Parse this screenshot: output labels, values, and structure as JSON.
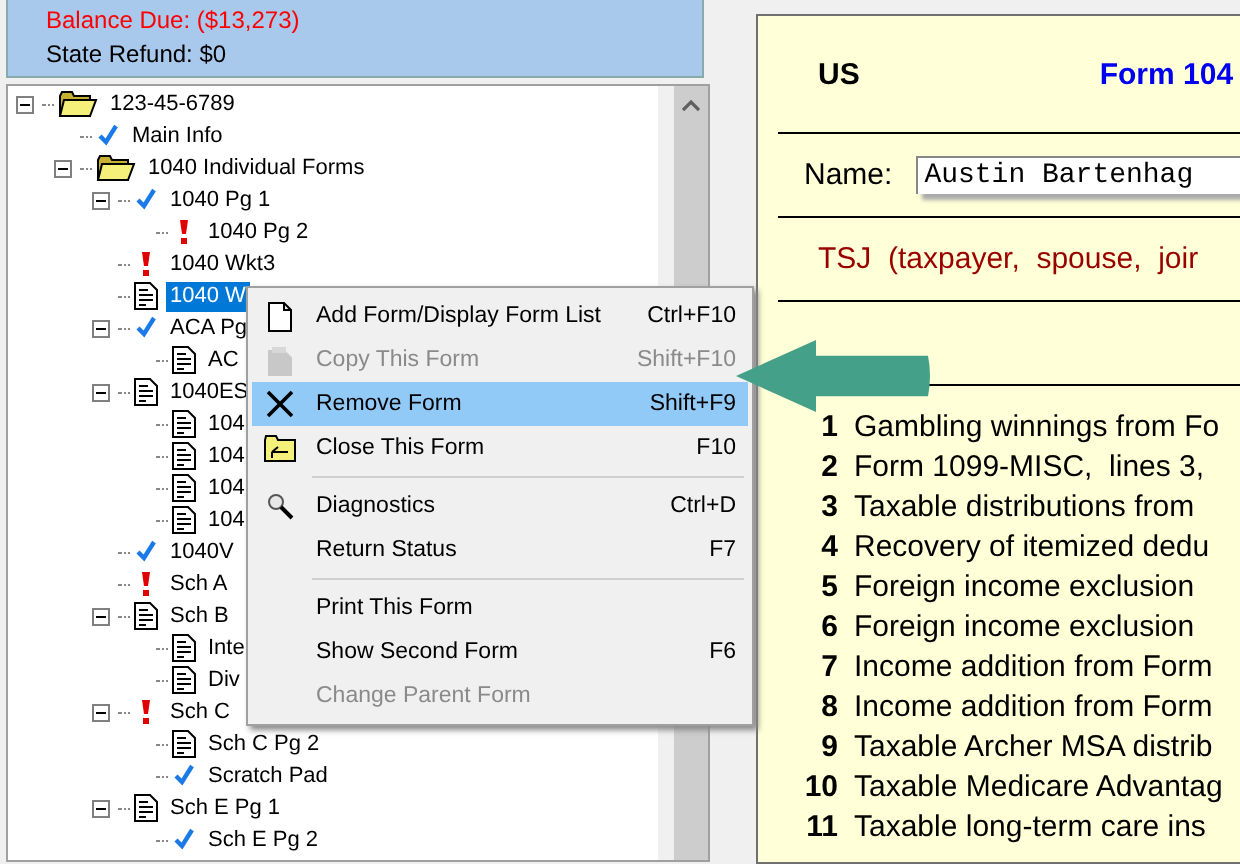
{
  "summary": {
    "balance_due": "Balance Due: ($13,273)",
    "state_refund": "State Refund: $0"
  },
  "tree": [
    {
      "label": "123-45-6789",
      "kind": "folder",
      "selected": false,
      "expanded": true,
      "children": [
        {
          "label": "Main Info",
          "kind": "check",
          "selected": false
        },
        {
          "label": "1040 Individual Forms",
          "kind": "folder",
          "selected": false,
          "expanded": true,
          "children": [
            {
              "label": "1040 Pg 1",
              "kind": "check",
              "selected": false,
              "expanded": true,
              "children": [
                {
                  "label": "1040 Pg 2",
                  "kind": "alert",
                  "selected": false
                }
              ]
            },
            {
              "label": "1040 Wkt3",
              "kind": "alert",
              "selected": false
            },
            {
              "label": "1040 W",
              "kind": "form",
              "selected": true
            },
            {
              "label": "ACA Pg",
              "kind": "check",
              "selected": false,
              "expanded": true,
              "children": [
                {
                  "label": "AC",
                  "kind": "form",
                  "selected": false
                }
              ]
            },
            {
              "label": "1040ES",
              "kind": "form",
              "selected": false,
              "expanded": true,
              "children": [
                {
                  "label": "104",
                  "kind": "form",
                  "selected": false
                },
                {
                  "label": "104",
                  "kind": "form",
                  "selected": false
                },
                {
                  "label": "104",
                  "kind": "form",
                  "selected": false
                },
                {
                  "label": "104",
                  "kind": "form",
                  "selected": false
                }
              ]
            },
            {
              "label": "1040V",
              "kind": "check",
              "selected": false
            },
            {
              "label": "Sch A",
              "kind": "alert",
              "selected": false
            },
            {
              "label": "Sch B",
              "kind": "form",
              "selected": false,
              "expanded": true,
              "children": [
                {
                  "label": "Inte",
                  "kind": "form",
                  "selected": false
                },
                {
                  "label": "Div",
                  "kind": "form",
                  "selected": false
                }
              ]
            },
            {
              "label": "Sch C",
              "kind": "alert",
              "selected": false,
              "expanded": true,
              "children": [
                {
                  "label": "Sch C Pg 2",
                  "kind": "form",
                  "selected": false
                },
                {
                  "label": "Scratch Pad",
                  "kind": "check",
                  "selected": false
                }
              ]
            },
            {
              "label": "Sch E Pg 1",
              "kind": "form",
              "selected": false,
              "expanded": true,
              "children": [
                {
                  "label": "Sch E Pg 2",
                  "kind": "check",
                  "selected": false
                }
              ]
            }
          ]
        }
      ]
    }
  ],
  "context_menu": [
    {
      "kind": "page",
      "label": "Add Form/Display Form List",
      "shortcut": "Ctrl+F10",
      "disabled": false,
      "selected": false,
      "separator_after": false
    },
    {
      "kind": "copy",
      "label": "Copy This Form",
      "shortcut": "Shift+F10",
      "disabled": true,
      "selected": false,
      "separator_after": false
    },
    {
      "kind": "x",
      "label": "Remove Form",
      "shortcut": "Shift+F9",
      "disabled": false,
      "selected": true,
      "separator_after": false
    },
    {
      "kind": "folder",
      "label": "Close This Form",
      "shortcut": "F10",
      "disabled": false,
      "selected": false,
      "separator_after": true
    },
    {
      "kind": "magnifier",
      "label": "Diagnostics",
      "shortcut": "Ctrl+D",
      "disabled": false,
      "selected": false,
      "separator_after": false
    },
    {
      "kind": "plain",
      "label": "Return Status",
      "shortcut": "F7",
      "disabled": false,
      "selected": false,
      "separator_after": true
    },
    {
      "kind": "plain",
      "label": "Print This Form",
      "disabled": false,
      "selected": false,
      "separator_after": false
    },
    {
      "kind": "plain",
      "label": "Show Second Form",
      "shortcut": "F6",
      "disabled": false,
      "selected": false,
      "separator_after": false
    },
    {
      "kind": "plain",
      "label": "Change Parent Form",
      "disabled": true,
      "selected": false,
      "separator_after": false
    }
  ],
  "form": {
    "country": "US",
    "title": "Form 104",
    "name_label": "Name:",
    "name_value": "Austin Bartenhag",
    "filer_note": "TSJ  (taxpayer,  spouse,  joir",
    "lines": [
      {
        "number": "1",
        "text": "Gambling winnings from Fo"
      },
      {
        "number": "2",
        "text": "Form 1099-MISC,  lines 3,"
      },
      {
        "number": "3",
        "text": "Taxable distributions from"
      },
      {
        "number": "4",
        "text": "Recovery of itemized dedu"
      },
      {
        "number": "5",
        "text": "Foreign income exclusion"
      },
      {
        "number": "6",
        "text": "Foreign income exclusion"
      },
      {
        "number": "7",
        "text": "Income addition from Form"
      },
      {
        "number": "8",
        "text": "Income addition from Form"
      },
      {
        "number": "9",
        "text": "Taxable Archer MSA distrib"
      },
      {
        "number": "10",
        "text": "Taxable Medicare Advantag"
      },
      {
        "number": "11",
        "text": "Taxable long-term care ins"
      }
    ]
  }
}
